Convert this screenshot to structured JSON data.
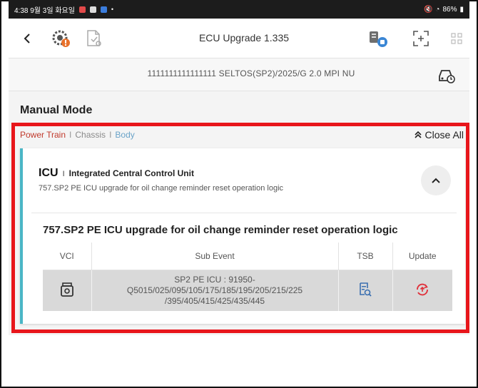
{
  "status_bar": {
    "time_text": "4:38 9월 3일 화요일",
    "battery_text": "86%"
  },
  "header": {
    "title": "ECU Upgrade 1.335"
  },
  "vehicle": {
    "info": "1111111111111111 SELTOS(SP2)/2025/G 2.0 MPI NU"
  },
  "section": {
    "title": "Manual Mode"
  },
  "filters": {
    "power_train": "Power Train",
    "separator": "I",
    "chassis": "Chassis",
    "body": "Body"
  },
  "close_all": {
    "label": "Close All"
  },
  "card": {
    "ecu_code": "ICU",
    "separator": "I",
    "ecu_name": "Integrated Central Control Unit",
    "ecu_subtitle": "757.SP2 PE ICU upgrade for oil change reminder reset operation logic",
    "event_title": "757.SP2 PE ICU upgrade for oil change reminder reset operation logic",
    "table": {
      "headers": [
        "VCI",
        "Sub Event",
        "TSB",
        "Update"
      ],
      "rows": [
        {
          "sub_event_lines": [
            "SP2 PE ICU : 91950-",
            "Q5015/025/095/105/175/185/195/205/215/225",
            "/395/405/415/425/435/445"
          ]
        }
      ]
    }
  },
  "colors": {
    "highlight": "#e8161b",
    "card_accent": "#4ab6c6",
    "update_icon": "#e0303a",
    "tsb_icon": "#3a6fb0"
  },
  "icons": {
    "back": "back-chevron-icon",
    "diagnose": "gear-warning-icon",
    "document": "document-icon",
    "vehicle_db": "database-icon",
    "fullscreen": "fullscreen-icon",
    "grid": "grid-icon",
    "vehicle_check": "vehicle-check-icon",
    "vci": "vci-device-icon",
    "tsb": "tsb-search-icon",
    "update": "update-refresh-icon",
    "close_all": "double-chevron-up-icon",
    "collapse": "chevron-up-icon"
  }
}
